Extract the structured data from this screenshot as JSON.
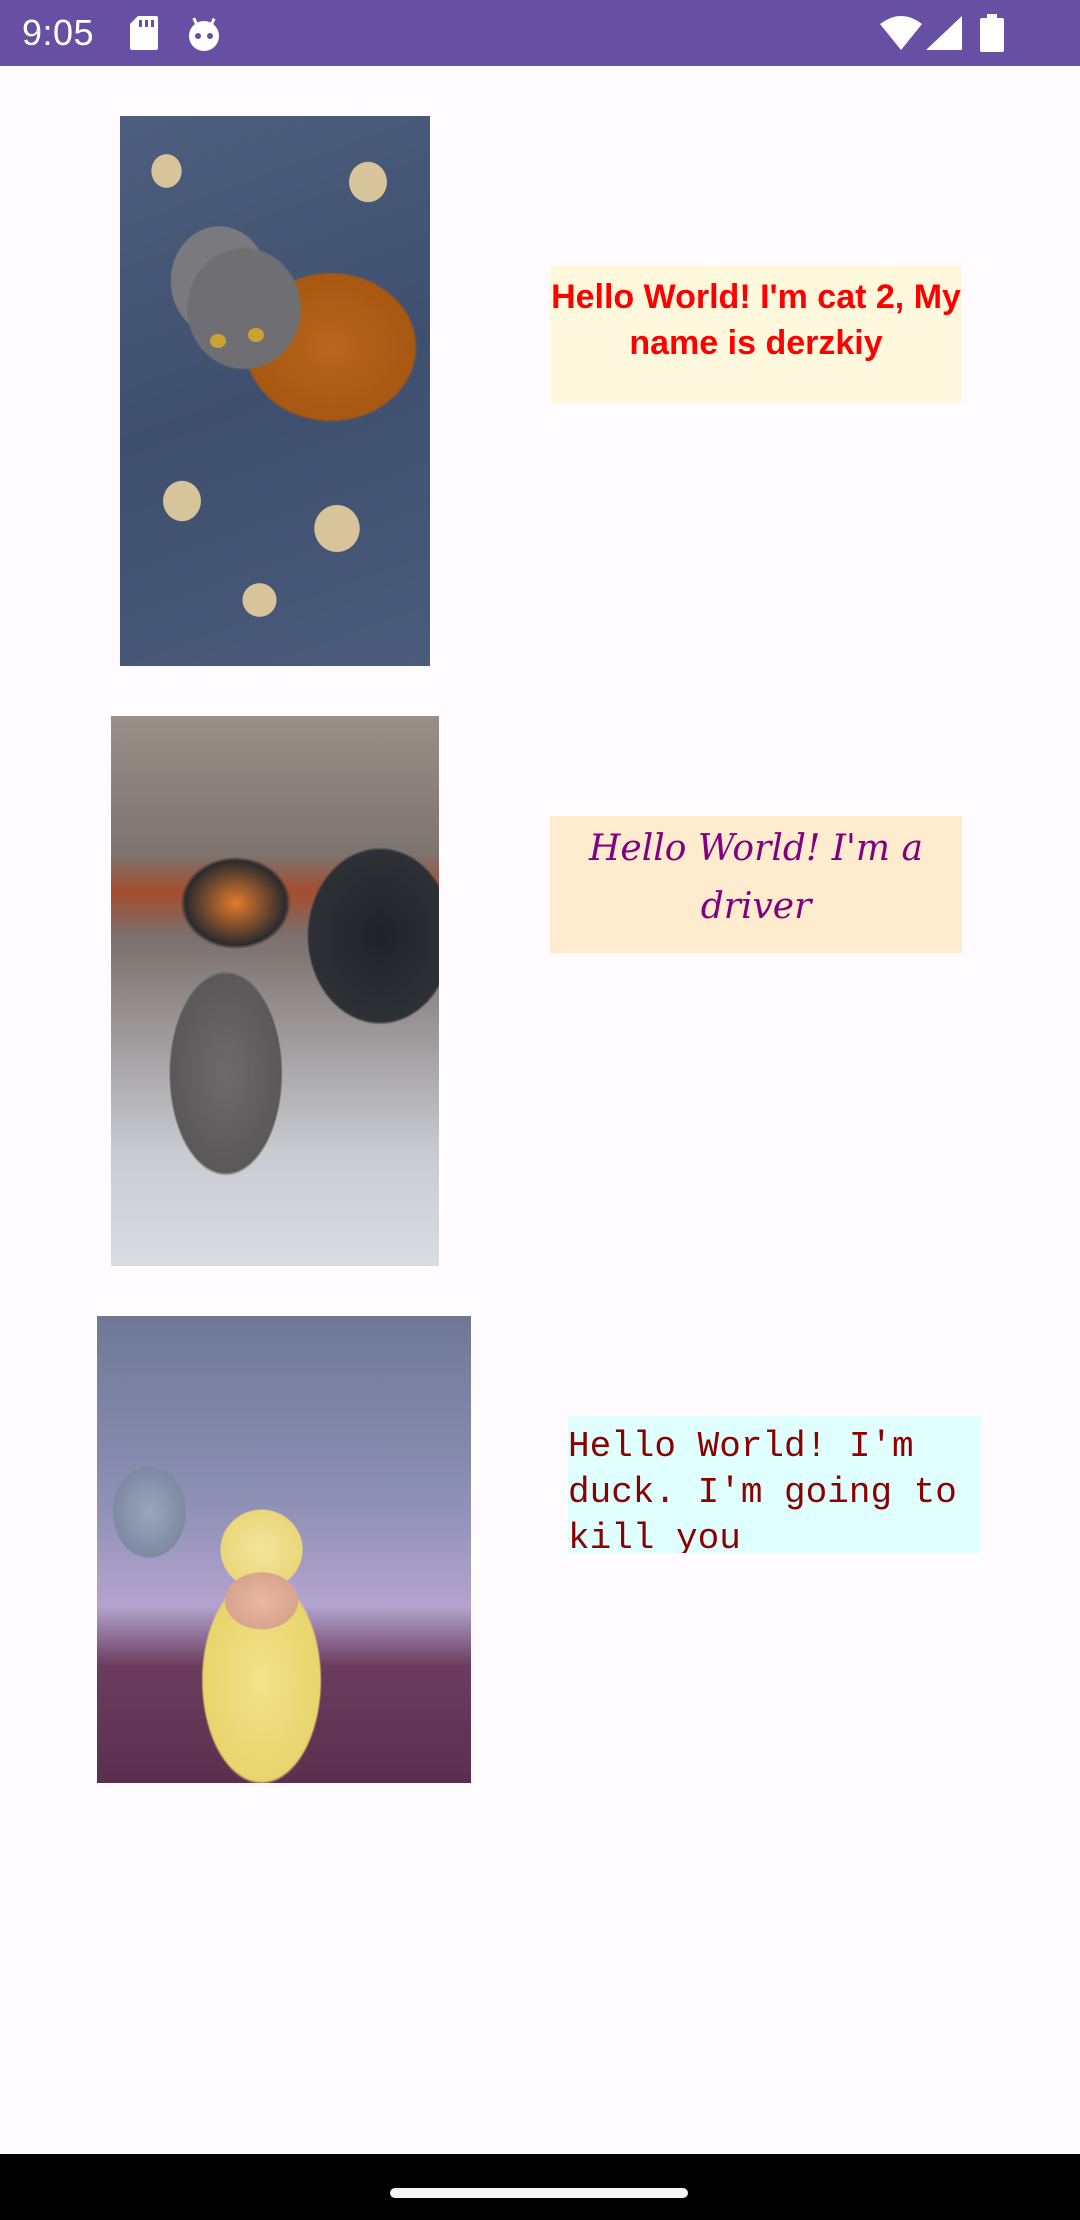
{
  "status_bar": {
    "time": "9:05",
    "icons": [
      "sd-card-icon",
      "robot-icon",
      "wifi-icon",
      "signal-icon",
      "battery-icon"
    ],
    "background": "#6750a4"
  },
  "rows": [
    {
      "photo": "cat in orange jacket on floral blanket",
      "caption": "Hello World! I'm cat 2, My name is derzkiy",
      "caption_color": "#ff0000",
      "caption_background": "#fff8dc"
    },
    {
      "photo": "cat in motorcycle helmet with rider",
      "caption": "Hello World! I'm a driver",
      "caption_color": "#800080",
      "caption_background": "#ffebcd"
    },
    {
      "photo": "duckling close-up",
      "caption": "Hello World! I'm duck. I'm going to kill you",
      "caption_color": "#8b0000",
      "caption_background": "#e0ffff"
    }
  ],
  "nav_bar": {
    "handle": "home-handle"
  }
}
